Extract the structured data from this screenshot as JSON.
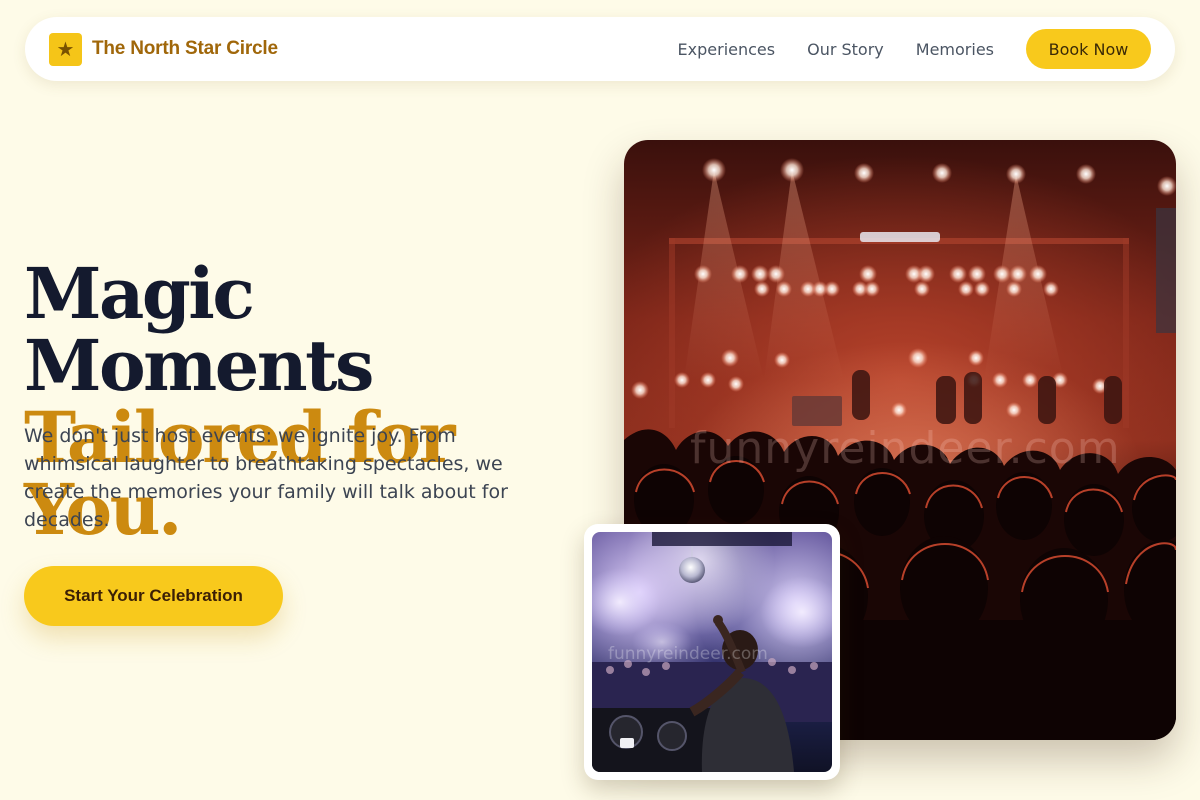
{
  "nav": {
    "brand": {
      "icon": "star-icon",
      "name": "The North Star Circle"
    },
    "links": [
      {
        "label": "Experiences"
      },
      {
        "label": "Our Story"
      },
      {
        "label": "Memories"
      }
    ],
    "cta_label": "Book Now"
  },
  "hero": {
    "title_line_1": "Magic Moments",
    "title_line_2": "Tailored for You.",
    "description": "We don't just host events: we ignite joy. From whimsical laughter to breathtaking spectacles, we create the memories your family will talk about for decades.",
    "cta_label": "Start Your Celebration"
  },
  "images": {
    "concert": {
      "subject": "concert crowd facing stage with red lights",
      "watermark": "funnyreindeer.com"
    },
    "dj": {
      "subject": "DJ at decks with smoke and crowd",
      "watermark": "funnyreindeer.com"
    }
  },
  "colors": {
    "background": "#fefbe8",
    "accent_yellow": "#f8c91c",
    "brand_text": "#a0670a",
    "title_dark": "#141a2e",
    "title_gold": "#cc8a10"
  }
}
